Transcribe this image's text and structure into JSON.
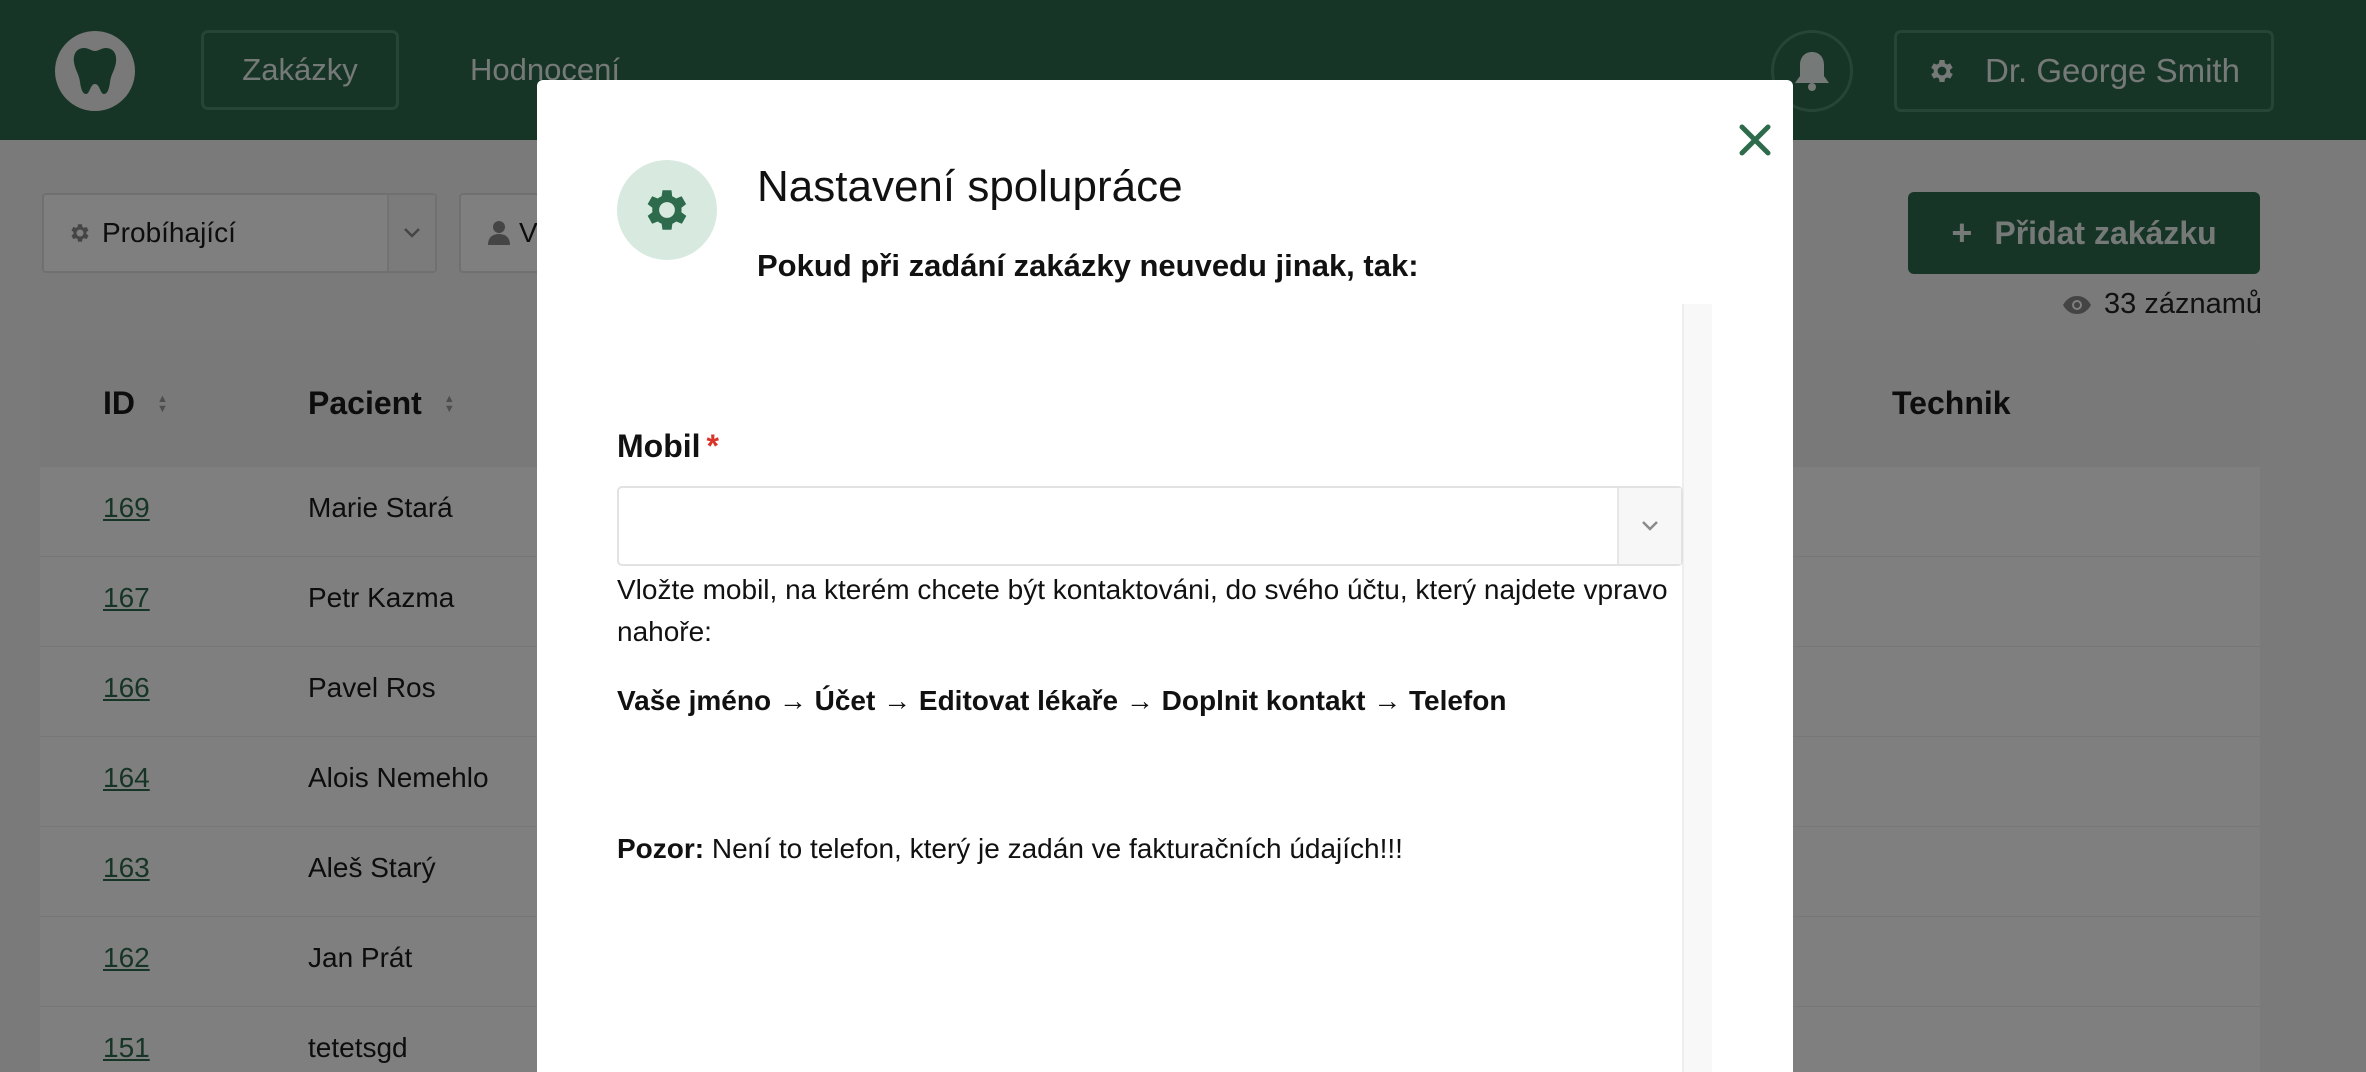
{
  "colors": {
    "brand_green": "#2e6b4c",
    "icon_bg": "#d8eae0",
    "required": "#d9332a",
    "link": "#2e6b4c"
  },
  "nav": {
    "logo_icon": "tooth-icon",
    "items": [
      {
        "label": "Zakázky",
        "active": true
      },
      {
        "label": "Hodnocení",
        "active": false
      }
    ],
    "notifications_icon": "bell-icon",
    "user": {
      "icon": "gear-icon",
      "name": "Dr. George Smith"
    }
  },
  "toolbar": {
    "status_filter": {
      "icon": "gear-icon",
      "value": "Probíhající"
    },
    "user_filter": {
      "icon": "user-icon",
      "value": "V"
    },
    "add_button": {
      "icon": "plus-icon",
      "label": "Přidat zakázku"
    },
    "records": {
      "icon": "eye-icon",
      "text": "33 záznamů"
    }
  },
  "table": {
    "columns": [
      "ID",
      "Pacient",
      "Technik"
    ],
    "rows": [
      {
        "id": "169",
        "pacient": "Marie Stará"
      },
      {
        "id": "167",
        "pacient": "Petr Kazma"
      },
      {
        "id": "166",
        "pacient": "Pavel Ros"
      },
      {
        "id": "164",
        "pacient": "Alois Nemehlo"
      },
      {
        "id": "163",
        "pacient": "Aleš Starý"
      },
      {
        "id": "162",
        "pacient": "Jan Prát"
      },
      {
        "id": "151",
        "pacient": "tetetsgd"
      }
    ]
  },
  "modal": {
    "title": "Nastavení spolupráce",
    "subtitle": "Pokud při zadání zakázky neuvedu jinak, tak:",
    "close_icon": "close-icon",
    "header_icon": "gear-icon",
    "field": {
      "label": "Mobil",
      "required_mark": "*",
      "value": "",
      "help": "Vložte mobil, na kterém chcete být kontaktováni, do svého účtu, který najdete vpravo nahoře:",
      "path": "Vaše jméno → Účet → Editovat lékaře → Doplnit kontakt → Telefon"
    },
    "warning": {
      "label": "Pozor:",
      "text": "Není to telefon, který je zadán ve fakturačních údajích!!!"
    }
  }
}
